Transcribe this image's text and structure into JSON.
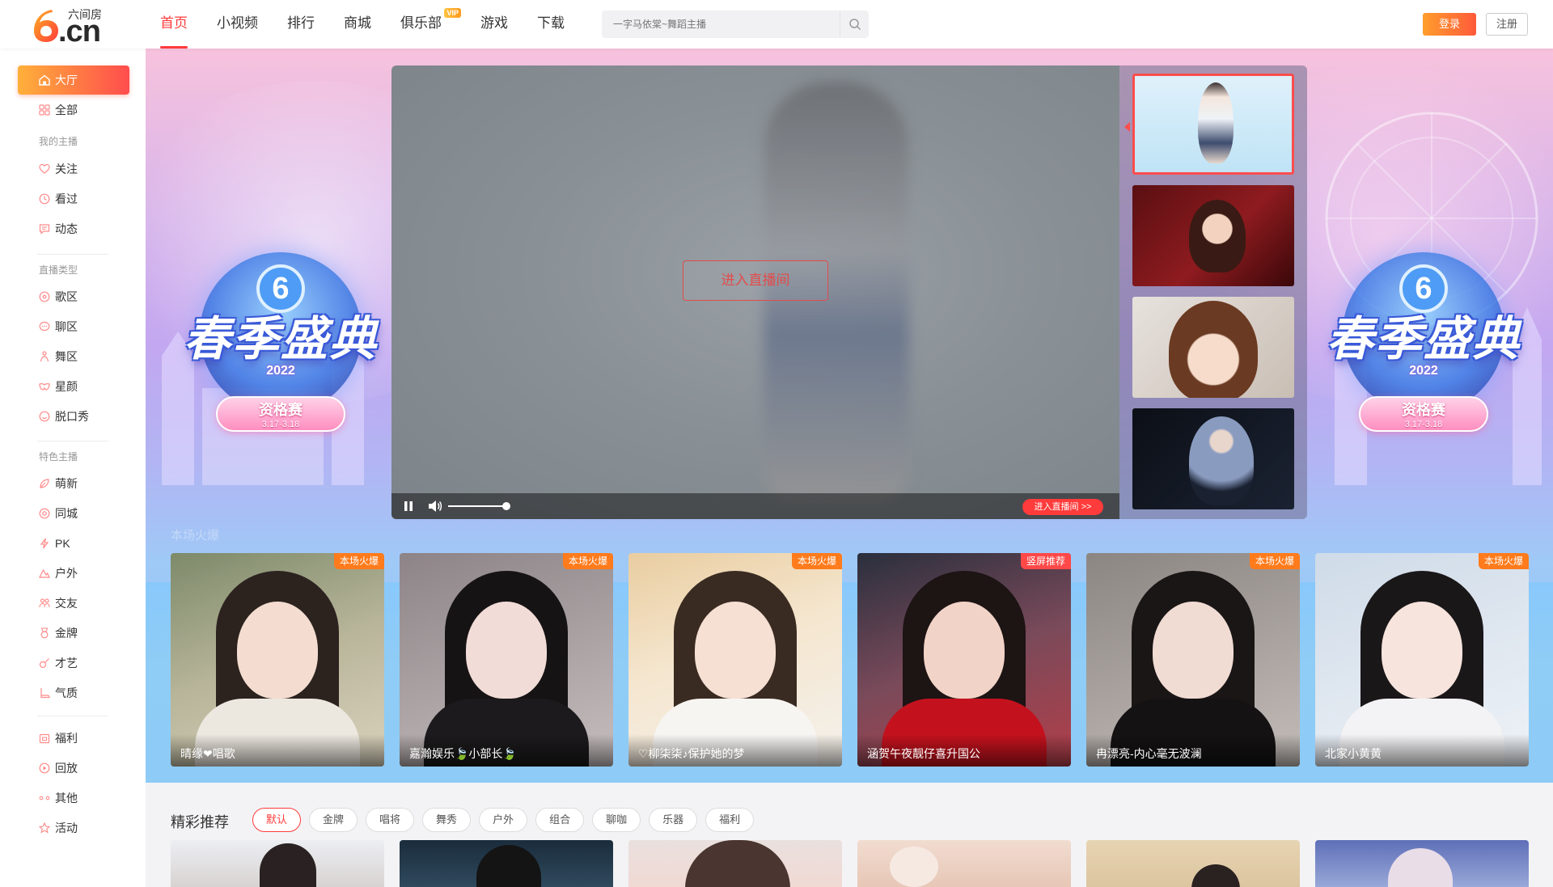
{
  "header": {
    "logo_cn": ".cn",
    "logo_name": "六间房",
    "nav": [
      {
        "label": "首页",
        "active": true
      },
      {
        "label": "小视频"
      },
      {
        "label": "排行"
      },
      {
        "label": "商城"
      },
      {
        "label": "俱乐部",
        "badge": "VIP"
      },
      {
        "label": "游戏"
      },
      {
        "label": "下载"
      }
    ],
    "search_placeholder": "一字马依棠~舞蹈主播",
    "login": "登录",
    "register": "注册"
  },
  "sidebar": {
    "hall": "大厅",
    "all": "全部",
    "my_title": "我的主播",
    "my": [
      "关注",
      "看过",
      "动态"
    ],
    "type_title": "直播类型",
    "types": [
      "歌区",
      "聊区",
      "舞区",
      "星颜",
      "脱口秀"
    ],
    "feature_title": "特色主播",
    "features": [
      "萌新",
      "同城",
      "PK",
      "户外",
      "交友",
      "金牌",
      "才艺",
      "气质"
    ],
    "others": [
      "福利",
      "回放",
      "其他",
      "活动"
    ]
  },
  "banner": {
    "event_title": "春季盛典",
    "event_year": "2022",
    "event_stage": "资格赛",
    "event_dates": "3.17-3.18",
    "badge_digit": "6"
  },
  "player": {
    "enter_label": "进入直播间",
    "live_link": "进入直播间 >>",
    "volume": 0.9
  },
  "hot": {
    "title": "本场火爆",
    "cards": [
      {
        "name": "晴缘❤唱歌",
        "tag": "本场火爆"
      },
      {
        "name": "嘉瀚娱乐🍃小部长🍃",
        "tag": "本场火爆"
      },
      {
        "name": "♡柳柒柒♪保护她的梦",
        "tag": "本场火爆"
      },
      {
        "name": "涵贺午夜靓仔喜升国公",
        "tag": "竖屏推荐"
      },
      {
        "name": "冉漂亮-内心毫无波澜",
        "tag": "本场火爆"
      },
      {
        "name": "北家小黄黄",
        "tag": "本场火爆"
      }
    ]
  },
  "recommend": {
    "title": "精彩推荐",
    "tabs": [
      "默认",
      "金牌",
      "唱将",
      "舞秀",
      "户外",
      "组合",
      "聊咖",
      "乐器",
      "福利"
    ]
  },
  "colors": {
    "accent": "#ff3b3b",
    "hot_tag": "#ff7b1c",
    "login_gradient": [
      "#ff9d2c",
      "#ff5a3a"
    ]
  }
}
